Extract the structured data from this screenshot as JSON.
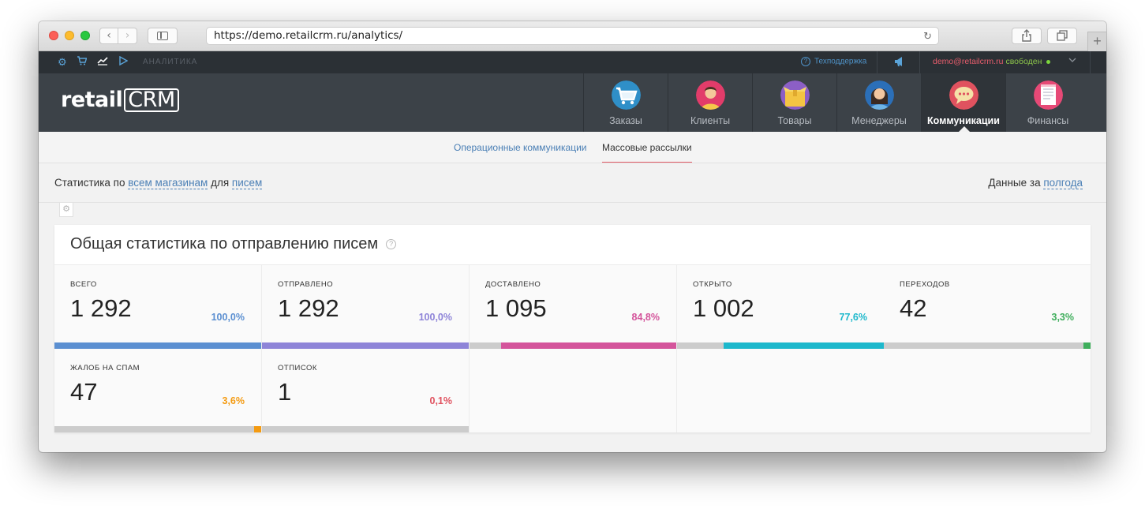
{
  "browser": {
    "url": "https://demo.retailcrm.ru/analytics/"
  },
  "topbar": {
    "section": "АНАЛИТИКА",
    "support": "Техподдержка",
    "user_email": "demo@retailcrm.ru",
    "user_status": "свободен"
  },
  "logo": {
    "retail": "retail",
    "crm": "CRM"
  },
  "modules": [
    {
      "label": "Заказы",
      "color": "#2f8fc8"
    },
    {
      "label": "Клиенты",
      "color": "#e23c6a"
    },
    {
      "label": "Товары",
      "color": "#8c5fc6"
    },
    {
      "label": "Менеджеры",
      "color": "#2b6fb8"
    },
    {
      "label": "Коммуникации",
      "color": "#e0525f",
      "active": true
    },
    {
      "label": "Финансы",
      "color": "#e64976"
    }
  ],
  "subnav": {
    "tab_operational": "Операционные коммуникации",
    "tab_mass": "Массовые рассылки"
  },
  "filters": {
    "prefix": "Статистика по",
    "shops": "всем магазинам",
    "for": "для",
    "letters": "писем",
    "period_prefix": "Данные за",
    "period": "полгода"
  },
  "card": {
    "title": "Общая статистика по отправлению писем",
    "stats": [
      {
        "label": "ВСЕГО",
        "value": "1 292",
        "percent": "100,0%",
        "fraction": 1.0,
        "color": "#5b8fd1"
      },
      {
        "label": "ОТПРАВЛЕНО",
        "value": "1 292",
        "percent": "100,0%",
        "fraction": 1.0,
        "color": "#8e84d8"
      },
      {
        "label": "ДОСТАВЛЕНО",
        "value": "1 095",
        "percent": "84,8%",
        "fraction": 0.848,
        "color": "#d4549b"
      },
      {
        "label": "ОТКРЫТО",
        "value": "1 002",
        "percent": "77,6%",
        "fraction": 0.776,
        "color": "#1db8cc"
      },
      {
        "label": "ПЕРЕХОДОВ",
        "value": "42",
        "percent": "3,3%",
        "fraction": 0.033,
        "color": "#3fae5c"
      },
      {
        "label": "ЖАЛОБ НА СПАМ",
        "value": "47",
        "percent": "3,6%",
        "fraction": 0.036,
        "color": "#f49b12"
      },
      {
        "label": "ОТПИСОК",
        "value": "1",
        "percent": "0,1%",
        "fraction": 0.001,
        "color": "#e0525f"
      }
    ]
  }
}
